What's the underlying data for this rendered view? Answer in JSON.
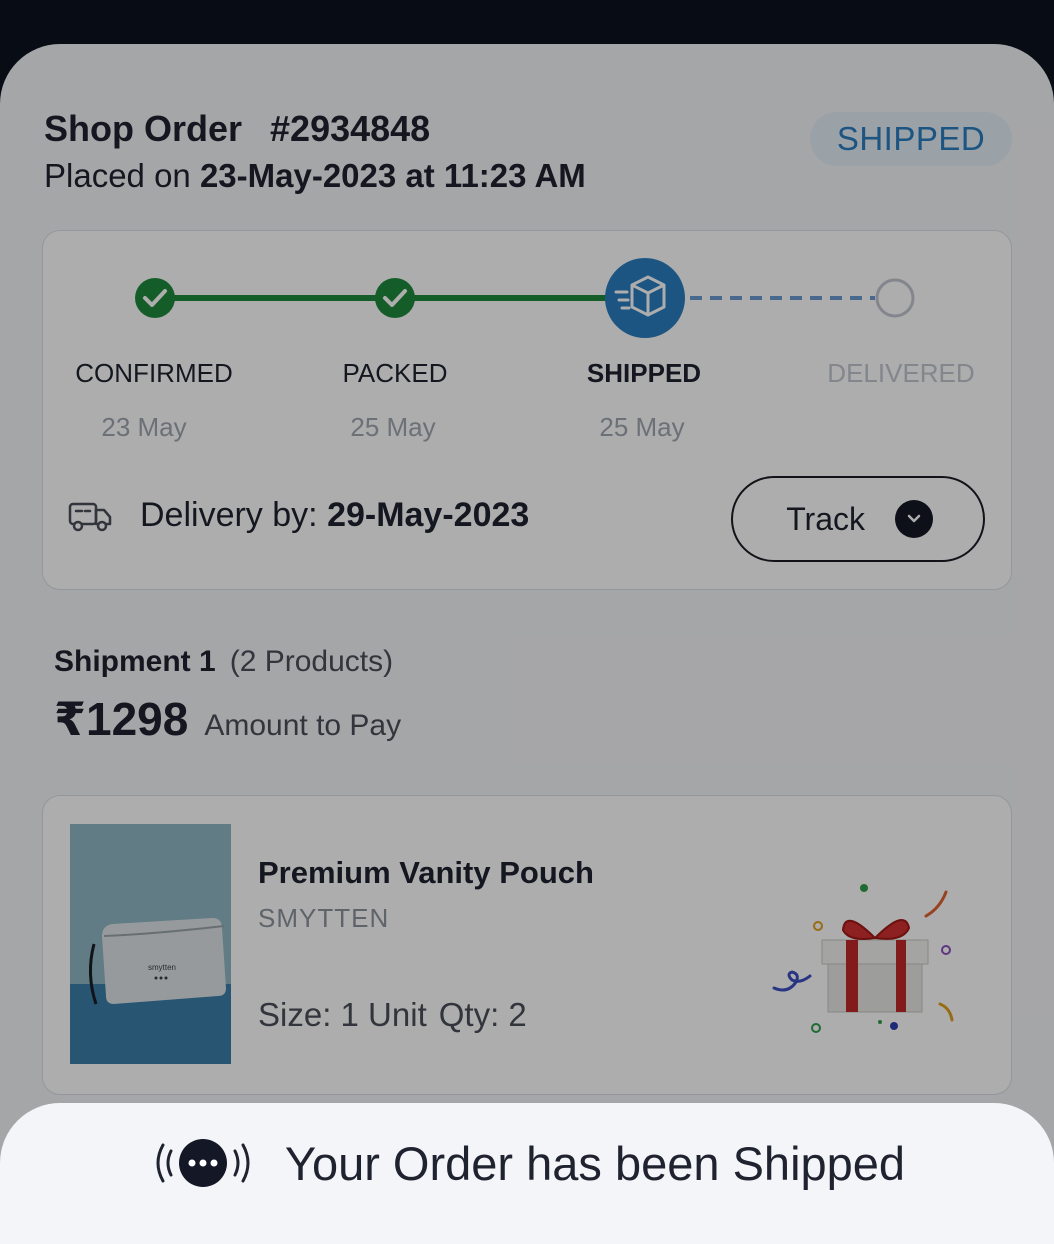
{
  "order": {
    "label": "Shop Order",
    "number": "#2934848",
    "placed_prefix": "Placed on ",
    "placed_datetime": "23-May-2023 at 11:23 AM",
    "status_badge": "SHIPPED"
  },
  "tracker": {
    "steps": [
      {
        "label": "CONFIRMED",
        "date": "23 May",
        "state": "done"
      },
      {
        "label": "PACKED",
        "date": "25 May",
        "state": "done"
      },
      {
        "label": "SHIPPED",
        "date": "25 May",
        "state": "current"
      },
      {
        "label": "DELIVERED",
        "date": "",
        "state": "pending"
      }
    ],
    "delivery_prefix": "Delivery by: ",
    "delivery_date": "29-May-2023",
    "track_label": "Track"
  },
  "shipment": {
    "title": "Shipment 1",
    "count": "(2 Products)",
    "amount": "₹1298",
    "amount_label": "Amount to Pay"
  },
  "product": {
    "name": "Premium Vanity Pouch",
    "brand": "SMYTTEN",
    "size": "Size: 1 Unit",
    "qty": "Qty: 2",
    "image_text": "smytten"
  },
  "toast": {
    "message": "Your Order has been Shipped"
  },
  "colors": {
    "done": "#1f8a3c",
    "current": "#2a7cc0",
    "pending": "#c1c6ce",
    "dark": "#1f2330"
  }
}
